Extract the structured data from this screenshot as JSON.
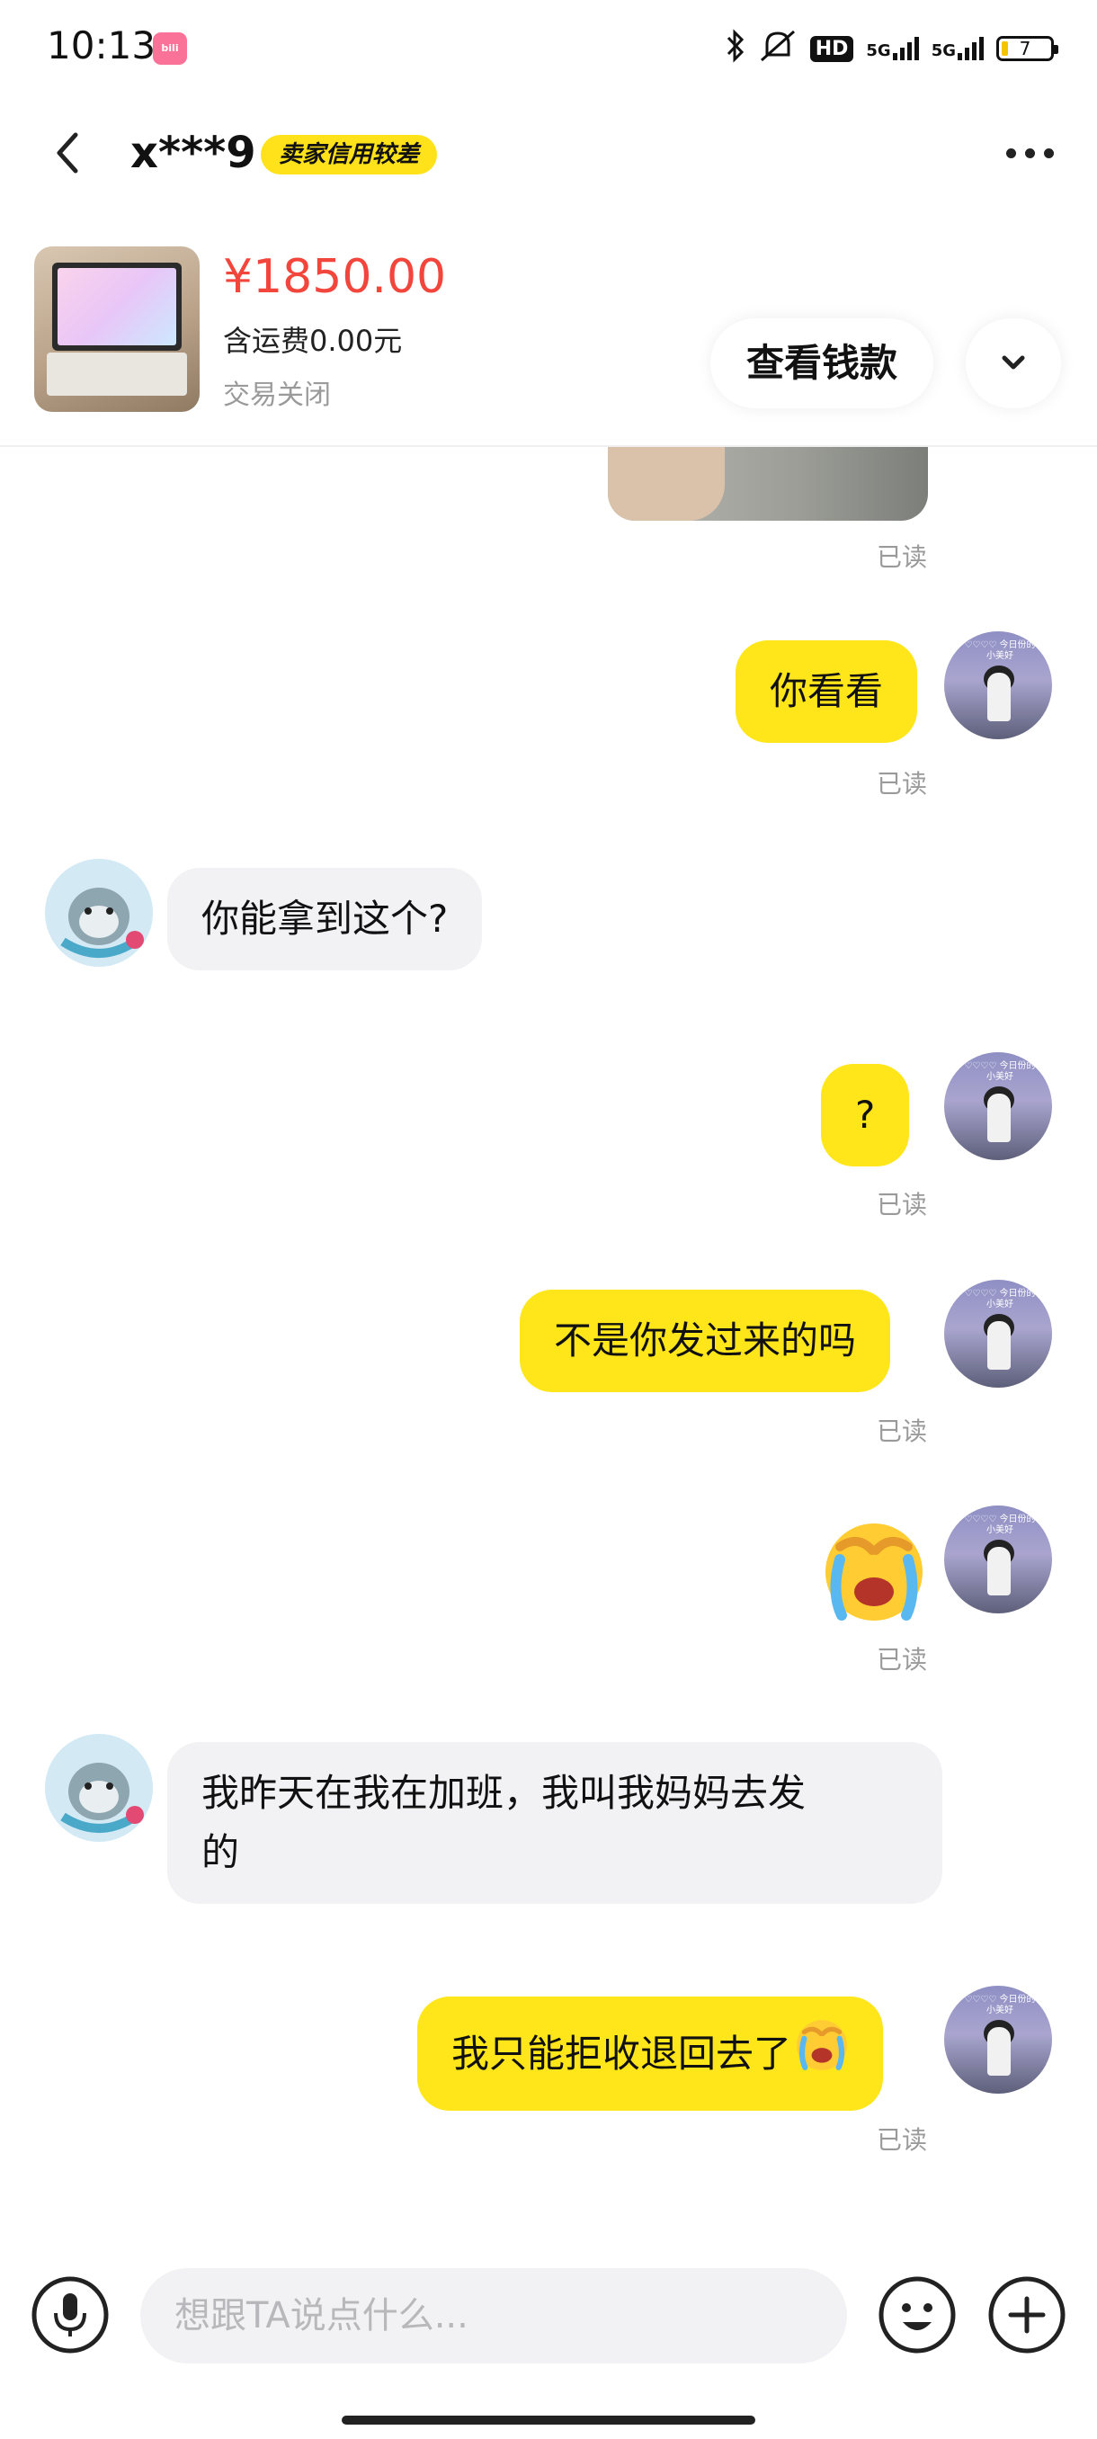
{
  "status_bar": {
    "time": "10:13",
    "app_badge_icon": "bilibili-icon",
    "hd_label": "HD",
    "network_1": "5G",
    "network_2": "5G",
    "battery": "7"
  },
  "header": {
    "user_name": "x***9",
    "credit_badge": "卖家信用较差"
  },
  "product": {
    "price": "¥1850.00",
    "shipping": "含运费0.00元",
    "status": "交易关闭",
    "view_button": "查看钱款"
  },
  "messages": {
    "read_label": "已读",
    "m1": "你看看",
    "m2": "你能拿到这个?",
    "m3": "?",
    "m4": "不是你发过来的吗",
    "m5_emoji": "crying-face-emoji",
    "m6_line1": "我昨天在我在加班，我叫我妈妈去发",
    "m6_line2": "的",
    "m7": "我只能拒收退回去了"
  },
  "input_bar": {
    "placeholder": "想跟TA说点什么..."
  },
  "colors": {
    "accent_yellow": "#ffe61a",
    "price_red": "#f2453b",
    "bubble_gray": "#f2f2f4"
  }
}
